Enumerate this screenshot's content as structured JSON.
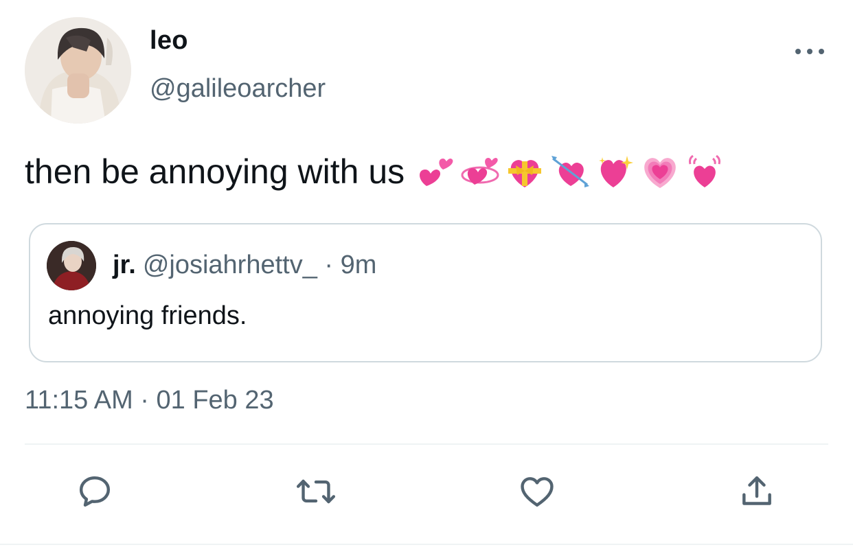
{
  "tweet": {
    "author": {
      "display_name": "leo",
      "handle": "@galileoarcher",
      "avatar_icon": "profile-photo"
    },
    "text": "then be annoying with us",
    "emojis": [
      "two-hearts-icon",
      "revolving-hearts-icon",
      "heart-with-ribbon-icon",
      "heart-with-arrow-icon",
      "sparkling-heart-icon",
      "growing-heart-icon",
      "beating-heart-icon"
    ],
    "quoted": {
      "display_name": "jr.",
      "meta": "@josiahrhettv_ · 9m",
      "text": "annoying friends."
    },
    "timestamp": "11:15 AM · 01 Feb 23"
  },
  "actions": [
    "reply-icon",
    "retweet-icon",
    "like-icon",
    "share-icon"
  ],
  "colors": {
    "text_primary": "#0f1419",
    "text_secondary": "#536471",
    "border": "#cfd9de",
    "heart_pink": "#f0479b"
  }
}
